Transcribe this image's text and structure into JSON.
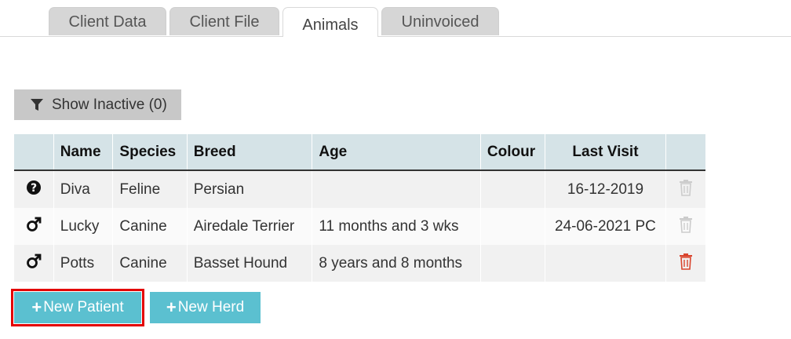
{
  "tabs": [
    {
      "label": "Client Data",
      "active": false
    },
    {
      "label": "Client File",
      "active": false
    },
    {
      "label": "Animals",
      "active": true
    },
    {
      "label": "Uninvoiced",
      "active": false
    }
  ],
  "filter": {
    "label": "Show Inactive (0)",
    "icon": "filter-icon"
  },
  "table": {
    "headers": [
      "",
      "Name",
      "Species",
      "Breed",
      "Age",
      "Colour",
      "Last Visit",
      ""
    ],
    "rows": [
      {
        "sex_icon": "unknown-sex-icon",
        "name": "Diva",
        "species": "Feline",
        "breed": "Persian",
        "age": "",
        "colour": "",
        "last_visit": "16-12-2019",
        "delete_enabled": false
      },
      {
        "sex_icon": "male-icon",
        "name": "Lucky",
        "species": "Canine",
        "breed": "Airedale Terrier",
        "age": "11 months and 3 wks",
        "colour": "",
        "last_visit": "24-06-2021 PC",
        "delete_enabled": false
      },
      {
        "sex_icon": "male-icon",
        "name": "Potts",
        "species": "Canine",
        "breed": "Basset Hound",
        "age": "8 years and 8 months",
        "colour": "",
        "last_visit": "",
        "delete_enabled": true
      }
    ]
  },
  "buttons": {
    "new_patient": "New Patient",
    "new_herd": "New Herd"
  },
  "colors": {
    "tab_inactive": "#d6d6d6",
    "header_bg": "#d5e3e7",
    "accent_button": "#5bc0d0",
    "highlight": "#e30000",
    "delete_active": "#d9452e",
    "delete_disabled": "#cccccc"
  }
}
